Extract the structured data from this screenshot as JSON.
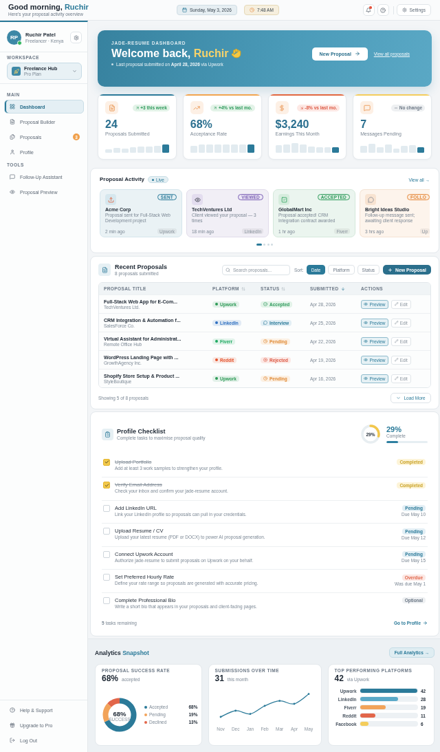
{
  "header": {
    "greeting": "Good morning,",
    "name": "Ruchir",
    "subtitle": "Here's your proposal activity overview",
    "date": "Sunday, May 3, 2026",
    "time": "7:48 AM",
    "has_notification": true,
    "settings": "Settings"
  },
  "sidebar": {
    "user": {
      "initials": "RP",
      "name": "Ruchir Patel",
      "role": "Freelancer · Kenya",
      "online": true
    },
    "workspace_label": "WORKSPACE",
    "workspace": {
      "name": "Freelance Hub",
      "plan": "Pro Plan"
    },
    "sections": [
      {
        "title": "MAIN",
        "items": [
          {
            "label": "Dashboard",
            "selected": true
          },
          {
            "label": "Proposal Builder",
            "selected": false
          },
          {
            "label": "Proposals",
            "selected": false,
            "badge": "3"
          },
          {
            "label": "Profile",
            "selected": false
          }
        ]
      },
      {
        "title": "TOOLS",
        "items": [
          {
            "label": "Follow-Up Assistant",
            "selected": false
          },
          {
            "label": "Proposal Preview",
            "selected": false
          }
        ]
      }
    ],
    "footer_items": [
      "Help & Support",
      "Upgrade to Pro",
      "Log Out"
    ]
  },
  "hero": {
    "eyebrow": "JADE-RESUME DASHBOARD",
    "welcome": "Welcome back,",
    "name": "Ruchir",
    "note": "Last proposal submitted on **April 28, 2026** via Upwork",
    "button": "New Proposal",
    "link": "View all proposals"
  },
  "stats": [
    {
      "value": "24",
      "label": "Proposals Submitted",
      "trend": "+3 this week",
      "kind": "up",
      "color": "#2b7a99"
    },
    {
      "value": "68%",
      "label": "Acceptance Rate",
      "trend": "+4% vs last mo.",
      "kind": "up",
      "color": "#f2a44e"
    },
    {
      "value": "$3,240",
      "label": "Earnings This Month",
      "trend": "-8% vs last mo.",
      "kind": "down",
      "color": "#e2673f"
    },
    {
      "value": "7",
      "label": "Messages Pending",
      "trend": "No change",
      "kind": "flat",
      "color": "#f4cd5c"
    }
  ],
  "activity": {
    "title": "Proposal Activity",
    "live": "Live",
    "view_all": "View all →",
    "items": [
      {
        "kind": "sent",
        "status": "SENT",
        "company": "Acme Corp",
        "description": "Proposal sent for Full-Stack Web Development project",
        "time": "2 min ago",
        "platform": "Upwork"
      },
      {
        "kind": "viewed",
        "status": "VIEWED",
        "company": "TechVentures Ltd",
        "description": "Client viewed your proposal — 3 times",
        "time": "18 min ago",
        "platform": "LinkedIn"
      },
      {
        "kind": "accepted",
        "status": "ACCEPTED",
        "company": "GlobalMart Inc",
        "description": "Proposal accepted! CRM Integration contract awarded",
        "time": "1 hr ago",
        "platform": "Fiverr"
      },
      {
        "kind": "followup",
        "status": "FOLLO",
        "company": "Bright Ideas Studio",
        "description": "Follow-up message sent; awaiting client response",
        "time": "3 hrs ago",
        "platform": "Up"
      }
    ],
    "pages": [
      {
        "selected": true
      },
      {
        "selected": false
      },
      {
        "selected": false
      },
      {
        "selected": false
      }
    ]
  },
  "recent": {
    "title": "Recent Proposals",
    "subtitle": "8 proposals submitted",
    "search_placeholder": "Search proposals...",
    "sort_label": "Sort:",
    "sort_options": [
      {
        "label": "Date",
        "selected": true
      },
      {
        "label": "Platform",
        "selected": false
      },
      {
        "label": "Status",
        "selected": false
      }
    ],
    "new_button": "New Proposal",
    "columns": [
      {
        "label": "PROPOSAL TITLE",
        "kind": "plain"
      },
      {
        "label": "PLATFORM",
        "kind": "sortable"
      },
      {
        "label": "STATUS",
        "kind": "sortable"
      },
      {
        "label": "SUBMITTED",
        "kind": "sorted_desc"
      },
      {
        "label": "ACTIONS",
        "kind": "plain"
      }
    ],
    "rows": [
      {
        "title": "Full-Stack Web App for E-Com...",
        "client": "TechVentures Ltd.",
        "platform": {
          "label": "Upwork",
          "color": "#2e9b57"
        },
        "status": {
          "kind": "accepted",
          "label": "Accepted"
        },
        "date": "Apr 28, 2026",
        "preview": "Preview",
        "edit": "Edit"
      },
      {
        "title": "CRM Integration & Automation f...",
        "client": "SalesForce Co.",
        "platform": {
          "label": "LinkedIn",
          "color": "#2d6fc0"
        },
        "status": {
          "kind": "interview",
          "label": "Interview"
        },
        "date": "Apr 25, 2026",
        "preview": "Preview",
        "edit": "Edit"
      },
      {
        "title": "Virtual Assistant for Administrat...",
        "client": "Remote Office Hub",
        "platform": {
          "label": "Fiverr",
          "color": "#1faa62"
        },
        "status": {
          "kind": "pending",
          "label": "Pending"
        },
        "date": "Apr 22, 2026",
        "preview": "Preview",
        "edit": "Edit"
      },
      {
        "title": "WordPress Landing Page with ...",
        "client": "GrowthAgency Inc.",
        "platform": {
          "label": "Reddit",
          "color": "#e5532d"
        },
        "status": {
          "kind": "rejected",
          "label": "Rejected"
        },
        "date": "Apr 19, 2026",
        "preview": "Preview",
        "edit": "Edit"
      },
      {
        "title": "Shopify Store Setup & Product ...",
        "client": "StyleBoutique",
        "platform": {
          "label": "Upwork",
          "color": "#2e9b57"
        },
        "status": {
          "kind": "pending",
          "label": "Pending"
        },
        "date": "Apr 16, 2026",
        "preview": "Preview",
        "edit": "Edit"
      }
    ],
    "footer": "Showing 5 of 8 proposals",
    "load_more": "Load More"
  },
  "checklist": {
    "title": "Profile Checklist",
    "subtitle": "Complete tasks to maximise proposal quality",
    "ring_label": "29%",
    "percent": "29%",
    "complete_label": "Complete",
    "level": 0.29,
    "items": [
      {
        "title": "Upload Portfolio",
        "description": "Add at least 3 work samples to strengthen your profile.",
        "checked": true,
        "status": {
          "kind": "completed",
          "label": "Completed"
        }
      },
      {
        "title": "Verify Email Address",
        "description": "Check your inbox and confirm your jade-resume account.",
        "checked": true,
        "status": {
          "kind": "completed",
          "label": "Completed"
        }
      },
      {
        "title": "Add LinkedIn URL",
        "description": "Link your LinkedIn profile so proposals can pull in your credentials.",
        "checked": false,
        "status": {
          "kind": "pending",
          "label": "Pending"
        },
        "due": "Due May 10"
      },
      {
        "title": "Upload Resume / CV",
        "description": "Upload your latest resume (PDF or DOCX) to power AI proposal generation.",
        "checked": false,
        "status": {
          "kind": "pending",
          "label": "Pending"
        },
        "due": "Due May 12"
      },
      {
        "title": "Connect Upwork Account",
        "description": "Authorize jade-resume to submit proposals on Upwork on your behalf.",
        "checked": false,
        "status": {
          "kind": "pending",
          "label": "Pending"
        },
        "due": "Due May 15"
      },
      {
        "title": "Set Preferred Hourly Rate",
        "description": "Define your rate range so proposals are generated with accurate pricing.",
        "checked": false,
        "status": {
          "kind": "overdue",
          "label": "Overdue"
        },
        "due": "Was due May 1"
      },
      {
        "title": "Complete Professional Bio",
        "description": "Write a short bio that appears in your proposals and client-facing pages.",
        "checked": false,
        "status": {
          "kind": "optional",
          "label": "Optional"
        }
      }
    ],
    "remaining": "**5** tasks remaining",
    "link": "Go to Profile"
  },
  "analytics": {
    "title": "Analytics",
    "accent": "Snapshot",
    "button": "Full Analytics →",
    "success": {
      "title": "PROPOSAL SUCCESS RATE",
      "value": "68%",
      "caption": "accepted",
      "center_value": "68%",
      "center_label": "SUCCESS",
      "slices": [
        {
          "color": "#2b7a99"
        },
        {
          "color": "#f2a35a"
        },
        {
          "color": "#e2664a"
        }
      ],
      "chart_data": {
        "type": "donut",
        "categories": [
          "Accepted",
          "Pending",
          "Declined"
        ],
        "values": [
          68,
          19,
          13
        ],
        "value_labels": [
          "68%",
          "19%",
          "13%"
        ],
        "legend": "right"
      }
    },
    "submissions": {
      "title": "SUBMISSIONS OVER TIME",
      "value": "31",
      "caption": "this month",
      "x_labels": [
        "Nov",
        "Dec",
        "Jan",
        "Feb",
        "Mar",
        "Apr",
        "May"
      ]
    },
    "platforms": {
      "title": "TOP PERFORMING PLATFORMS",
      "value": "42",
      "caption": "via Upwork",
      "rows": [
        {
          "label": "Upwork",
          "count": "42",
          "level": 1,
          "color": "#2b7a99"
        },
        {
          "label": "LinkedIn",
          "count": "28",
          "level": 0.667,
          "color": "#5aa9c8"
        },
        {
          "label": "Fiverr",
          "count": "19",
          "level": 0.452,
          "color": "#f2a35a"
        },
        {
          "label": "Reddit",
          "count": "11",
          "level": 0.262,
          "color": "#e2664a"
        },
        {
          "label": "Facebook",
          "count": "6",
          "level": 0.143,
          "color": "#f4cd5c"
        }
      ]
    }
  }
}
